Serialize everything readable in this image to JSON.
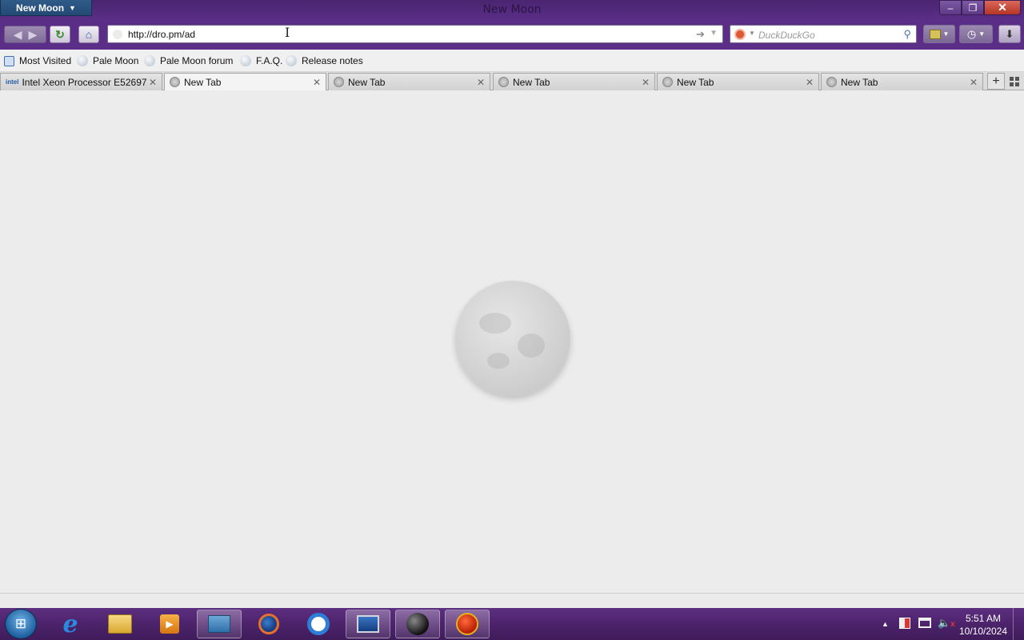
{
  "window": {
    "app_menu_label": "New Moon",
    "title": "New Moon",
    "controls": {
      "minimize": "–",
      "maximize": "❐",
      "close": "✕"
    }
  },
  "navbar": {
    "back_icon": "back-arrow-icon",
    "forward_icon": "forward-arrow-icon",
    "url": "http://dro.pm/ad",
    "search_placeholder": "DuckDuckGo",
    "search_engine_icon": "duckduckgo-icon"
  },
  "bookmarks": [
    {
      "label": "Most Visited",
      "icon": "most-visited-icon"
    },
    {
      "label": "Pale Moon",
      "icon": "moon-icon"
    },
    {
      "label": "Pale Moon forum",
      "icon": "moon-icon"
    },
    {
      "label": "F.A.Q.",
      "icon": "moon-icon"
    },
    {
      "label": "Release notes",
      "icon": "moon-icon"
    }
  ],
  "tabs": [
    {
      "label": "Intel Xeon Processor E52697",
      "favicon": "intel",
      "active": false
    },
    {
      "label": "New Tab",
      "favicon": "globe",
      "active": true
    },
    {
      "label": "New Tab",
      "favicon": "globe",
      "active": false
    },
    {
      "label": "New Tab",
      "favicon": "globe",
      "active": false
    },
    {
      "label": "New Tab",
      "favicon": "globe",
      "active": false
    },
    {
      "label": "New Tab",
      "favicon": "globe",
      "active": false
    }
  ],
  "tab_close_glyph": "✕",
  "intel_favicon_text": "intel",
  "content": {
    "logo": "pale-moon-logo"
  },
  "taskbar": {
    "apps": [
      "internet-explorer-icon",
      "file-explorer-icon",
      "media-player-icon",
      "control-panel-icon",
      "firefox-icon",
      "chrome-icon",
      "monitor-app-icon",
      "dark-sphere-icon",
      "red-sphere-icon"
    ],
    "clock_time": "5:51 AM",
    "clock_date": "10/10/2024"
  },
  "colors": {
    "titlebar": "#5a2e86",
    "taskbar": "#4b2269",
    "content_bg": "#ececec"
  }
}
